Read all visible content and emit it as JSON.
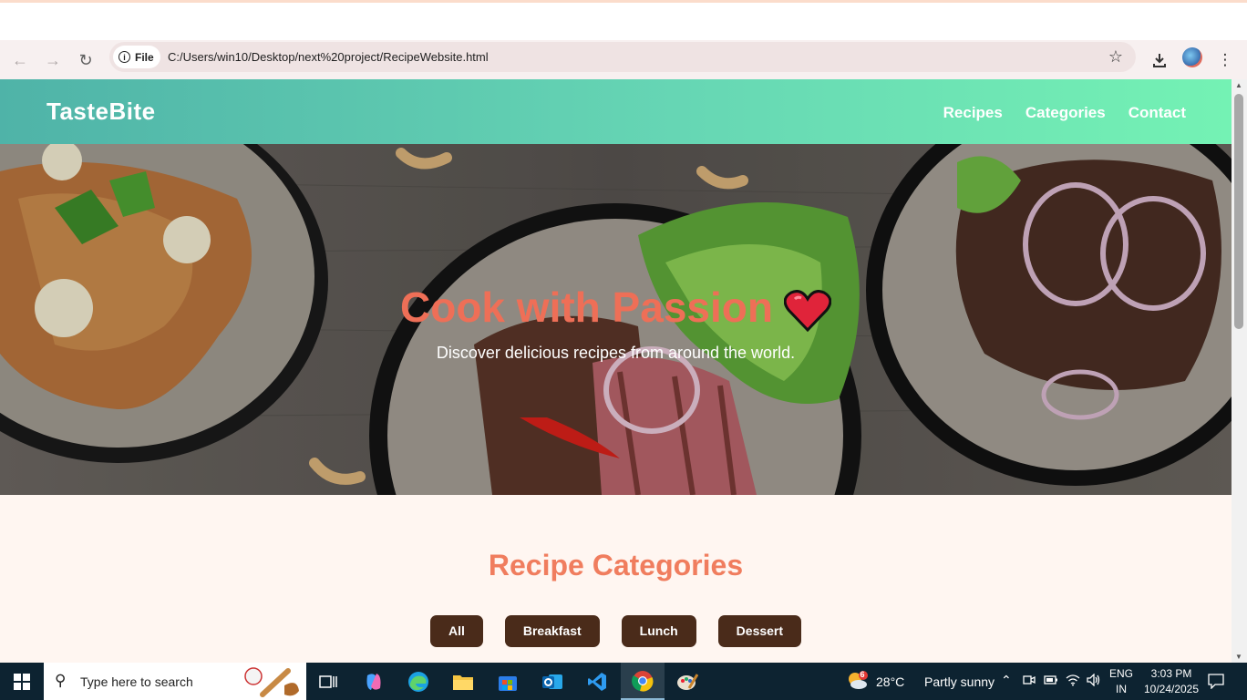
{
  "browser": {
    "site_chip_label": "File",
    "url": "C:/Users/win10/Desktop/next%20project/RecipeWebsite.html"
  },
  "site": {
    "logo": "TasteBite",
    "nav": [
      "Recipes",
      "Categories",
      "Contact"
    ],
    "hero_title": "Cook with Passion",
    "hero_subtitle": "Discover delicious recipes from around the world.",
    "categories_title": "Recipe Categories",
    "category_buttons": [
      "All",
      "Breakfast",
      "Lunch",
      "Dessert"
    ]
  },
  "taskbar": {
    "search_placeholder": "Type here to search",
    "weather_temp": "28°C",
    "weather_desc": "Partly sunny",
    "weather_badge": "6",
    "lang_line1": "ENG",
    "lang_line2": "IN",
    "time": "3:03 PM",
    "date": "10/24/2025"
  },
  "colors": {
    "header_gradient_start": "#4fb3a8",
    "header_gradient_end": "#74f2b4",
    "hero_title": "#ee6f57",
    "categories_title": "#f07d5e",
    "category_button_bg": "#4a2b1a",
    "page_bg": "#fff6f1"
  }
}
